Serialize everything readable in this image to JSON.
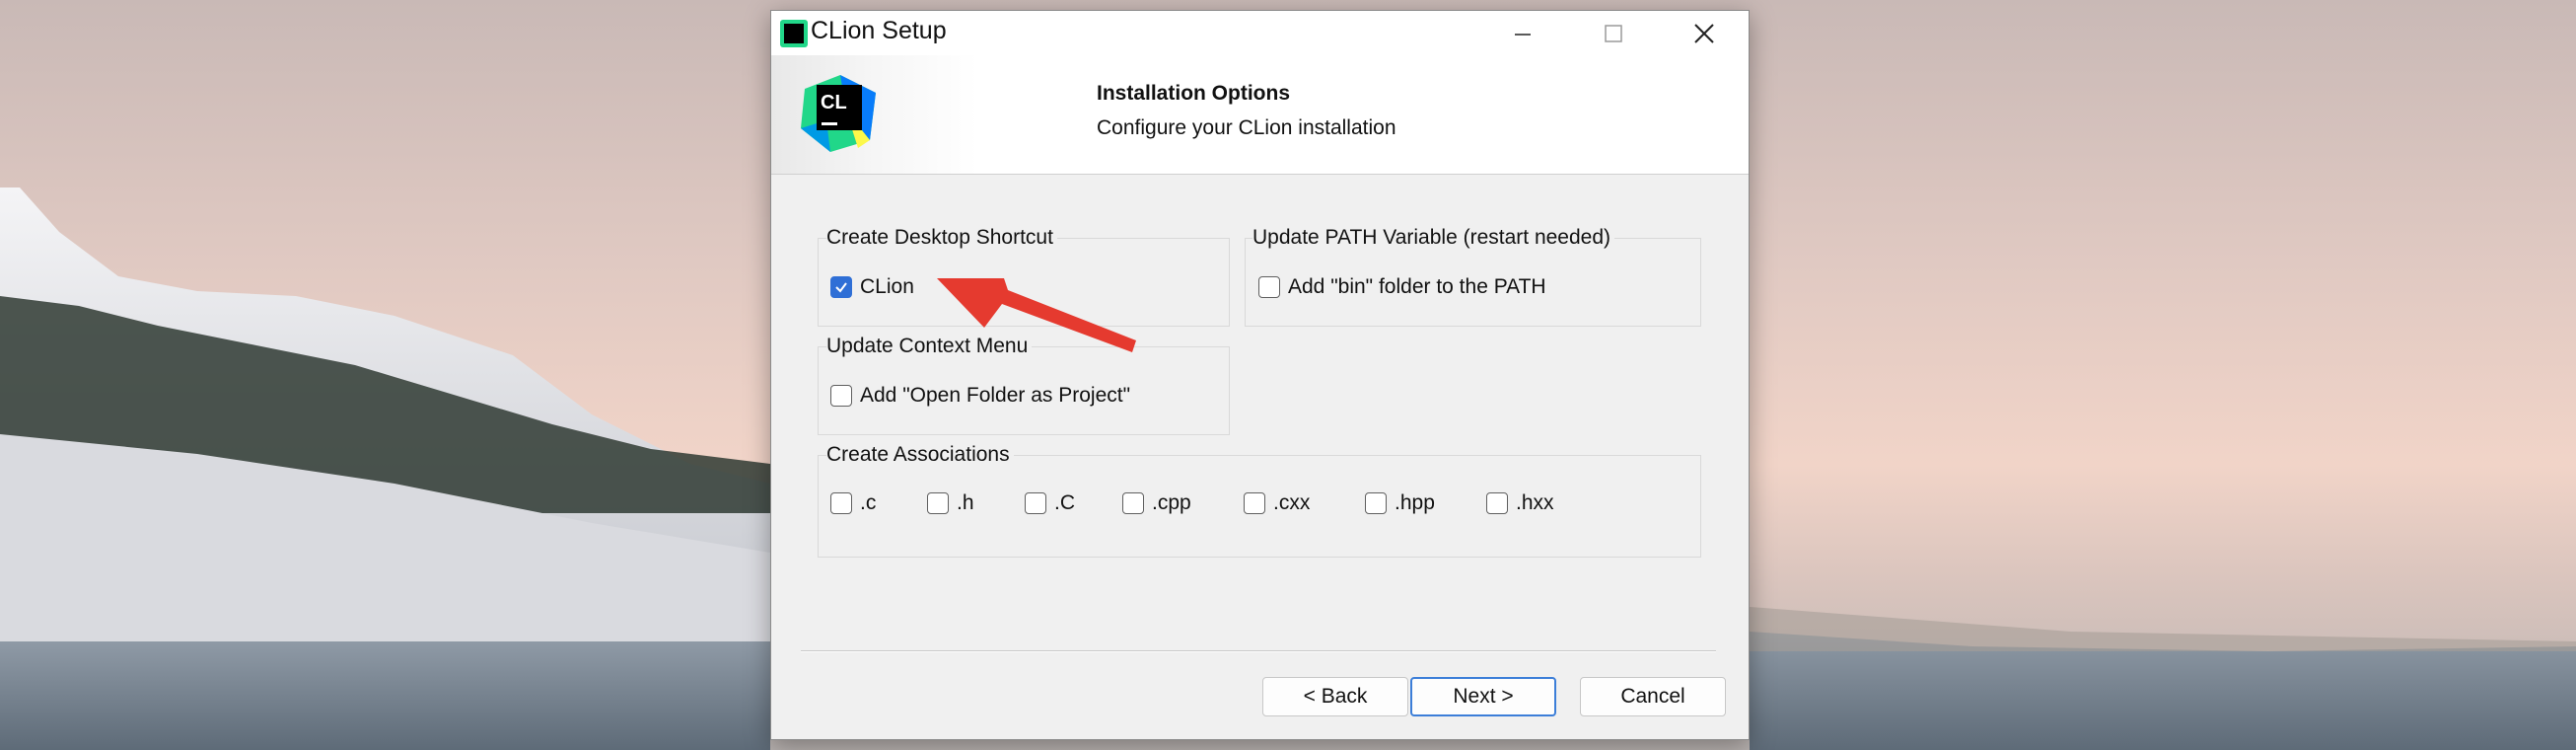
{
  "window": {
    "title": "CLion Setup",
    "app_icon_label": "CL",
    "controls": [
      "minimize-icon",
      "maximize-icon",
      "close-icon"
    ]
  },
  "header": {
    "title": "Installation Options",
    "subtitle": "Configure your CLion installation",
    "logo_label": "CL"
  },
  "groups": {
    "desktop_shortcut": {
      "label": "Create Desktop Shortcut",
      "options": [
        {
          "label": "CLion",
          "checked": true
        }
      ]
    },
    "path_variable": {
      "label": "Update PATH Variable (restart needed)",
      "options": [
        {
          "label": "Add \"bin\" folder to the PATH",
          "checked": false
        }
      ]
    },
    "context_menu": {
      "label": "Update Context Menu",
      "options": [
        {
          "label": "Add \"Open Folder as Project\"",
          "checked": false
        }
      ]
    },
    "associations": {
      "label": "Create Associations",
      "options": [
        {
          "label": ".c",
          "checked": false
        },
        {
          "label": ".h",
          "checked": false
        },
        {
          "label": ".C",
          "checked": false
        },
        {
          "label": ".cpp",
          "checked": false
        },
        {
          "label": ".cxx",
          "checked": false
        },
        {
          "label": ".hpp",
          "checked": false
        },
        {
          "label": ".hxx",
          "checked": false
        }
      ]
    }
  },
  "buttons": {
    "back": "< Back",
    "next": "Next >",
    "cancel": "Cancel"
  },
  "colors": {
    "accent": "#2f6fd6",
    "annotation_arrow": "#e53a2f"
  }
}
